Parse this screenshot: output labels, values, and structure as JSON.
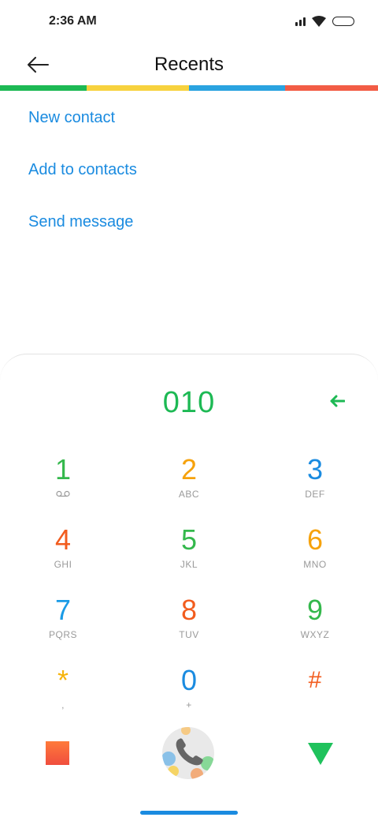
{
  "status_bar": {
    "time": "2:36 AM"
  },
  "app_bar": {
    "title": "Recents",
    "back_icon": "arrow-left-icon"
  },
  "accent_strip": [
    "#1db954",
    "#f7d23e",
    "#2aa3e0",
    "#f25c45"
  ],
  "actions": [
    {
      "label": "New contact"
    },
    {
      "label": "Add to contacts"
    },
    {
      "label": "Send message"
    }
  ],
  "dialer": {
    "number": "010",
    "backspace_icon": "backspace-arrow-icon",
    "keys": [
      {
        "digit": "1",
        "letters": "",
        "color": "#34b84c",
        "sub_icon": "voicemail-icon"
      },
      {
        "digit": "2",
        "letters": "ABC",
        "color": "#f6a20c"
      },
      {
        "digit": "3",
        "letters": "DEF",
        "color": "#1a8be0"
      },
      {
        "digit": "4",
        "letters": "GHI",
        "color": "#f25c1e"
      },
      {
        "digit": "5",
        "letters": "JKL",
        "color": "#34b84c"
      },
      {
        "digit": "6",
        "letters": "MNO",
        "color": "#f6a20c"
      },
      {
        "digit": "7",
        "letters": "PQRS",
        "color": "#1a9be6"
      },
      {
        "digit": "8",
        "letters": "TUV",
        "color": "#f25c1e"
      },
      {
        "digit": "9",
        "letters": "WXYZ",
        "color": "#34b84c"
      },
      {
        "digit": "*",
        "letters": ",",
        "color": "#f6b40c"
      },
      {
        "digit": "0",
        "letters": "+",
        "color": "#1a8be0"
      },
      {
        "digit": "#",
        "letters": "",
        "color": "#f25c1e"
      }
    ],
    "bottom_buttons": {
      "left_icon": "orange-square-icon",
      "call_icon": "phone-icon",
      "right_icon": "green-triangle-icon"
    }
  }
}
